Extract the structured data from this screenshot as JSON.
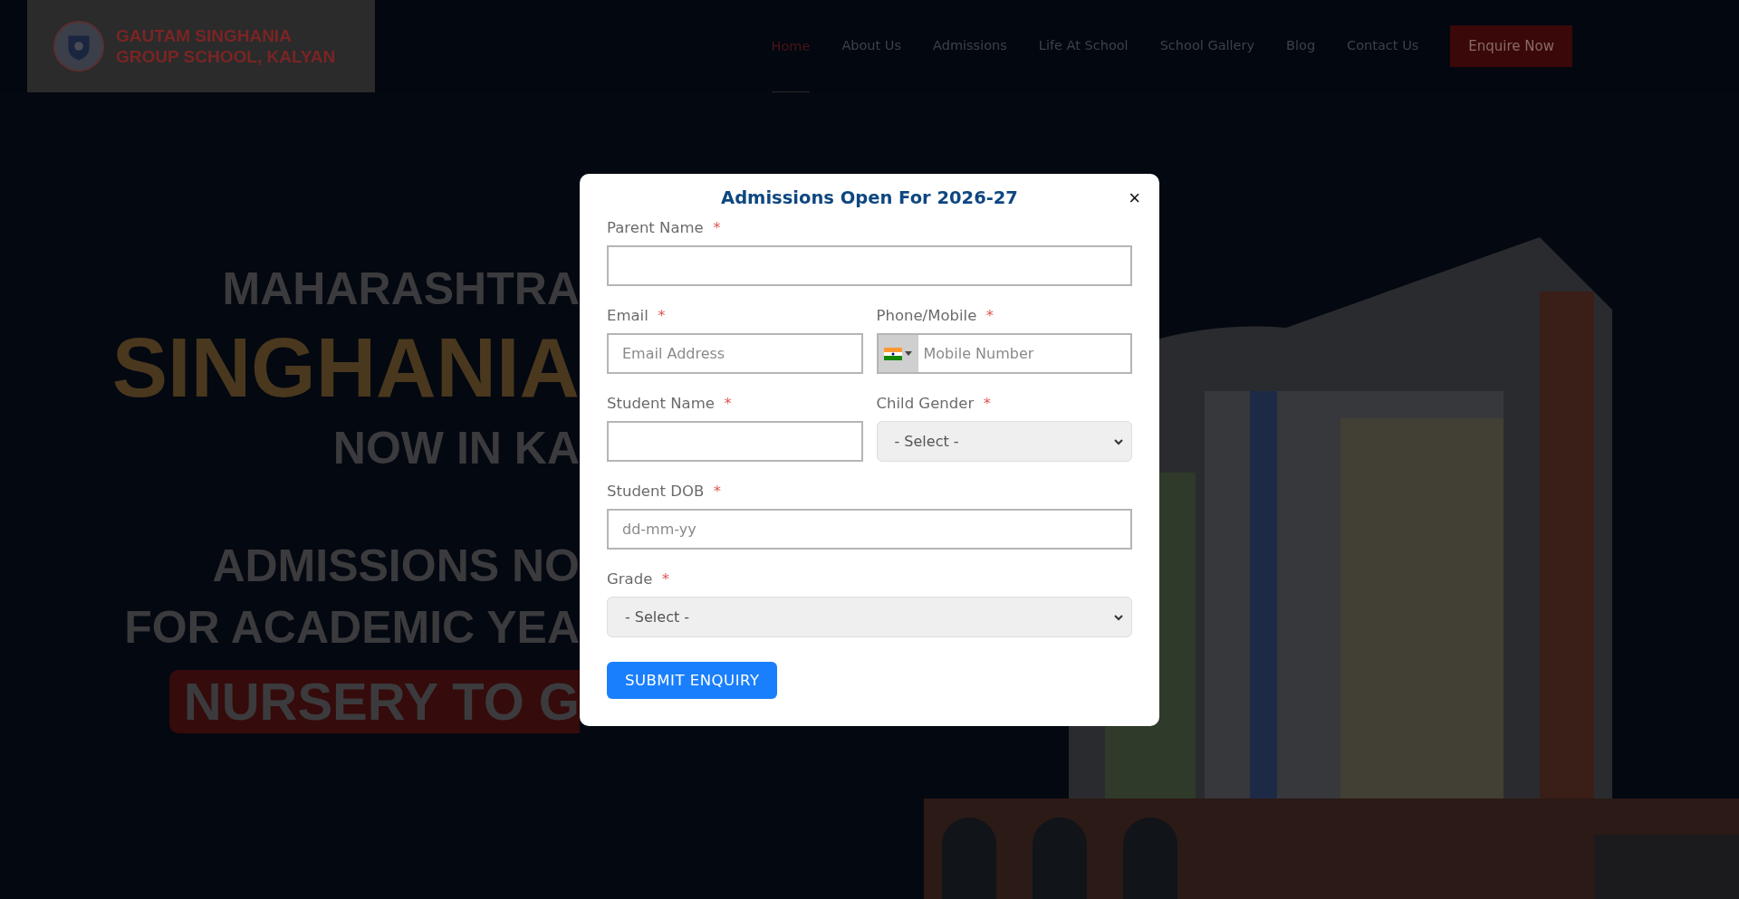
{
  "header": {
    "logo_text": [
      "GAUTAM SINGHANIA",
      "GROUP SCHOOL, KALYAN"
    ],
    "nav": [
      {
        "label": "Home",
        "selected": true
      },
      {
        "label": "About Us",
        "selected": false
      },
      {
        "label": "Admissions",
        "selected": false
      },
      {
        "label": "Life At School",
        "selected": false
      },
      {
        "label": "School Gallery",
        "selected": false
      },
      {
        "label": "Blog",
        "selected": false
      },
      {
        "label": "Contact Us",
        "selected": false
      }
    ],
    "cta": "Enquire Now"
  },
  "hero": {
    "lines": [
      {
        "text": "MAHARASHTRA",
        "kind": "plain"
      },
      {
        "text": "SINGHANIA",
        "kind": "gold"
      },
      {
        "text": "NOW IN KA",
        "kind": "plain"
      },
      {
        "text": "ADMISSIONS NO",
        "kind": "plain"
      },
      {
        "text": "FOR ACADEMIC YEA",
        "kind": "plain"
      },
      {
        "text": "NURSERY TO G",
        "kind": "banner"
      }
    ]
  },
  "modal": {
    "title": "Admissions Open For 2026-27",
    "close": "×",
    "rows": [
      [
        {
          "label": "Parent Name",
          "required": "*",
          "kind": "text"
        }
      ],
      [
        {
          "label": "Email",
          "required": "*",
          "kind": "text",
          "placeholder": "Email Address"
        },
        {
          "label": "Phone/Mobile",
          "required": "*",
          "kind": "phone",
          "placeholder": "Mobile Number"
        }
      ],
      [
        {
          "label": "Student Name",
          "required": "*",
          "kind": "text"
        },
        {
          "label": "Child Gender",
          "required": "*",
          "kind": "select",
          "value": "- Select -"
        }
      ],
      [
        {
          "label": "Student DOB",
          "required": "*",
          "kind": "text",
          "placeholder": "dd-mm-yy"
        }
      ],
      [
        {
          "label": "Grade",
          "required": "*",
          "kind": "select",
          "value": "- Select -"
        }
      ]
    ],
    "submit": "SUBMIT ENQUIRY"
  }
}
